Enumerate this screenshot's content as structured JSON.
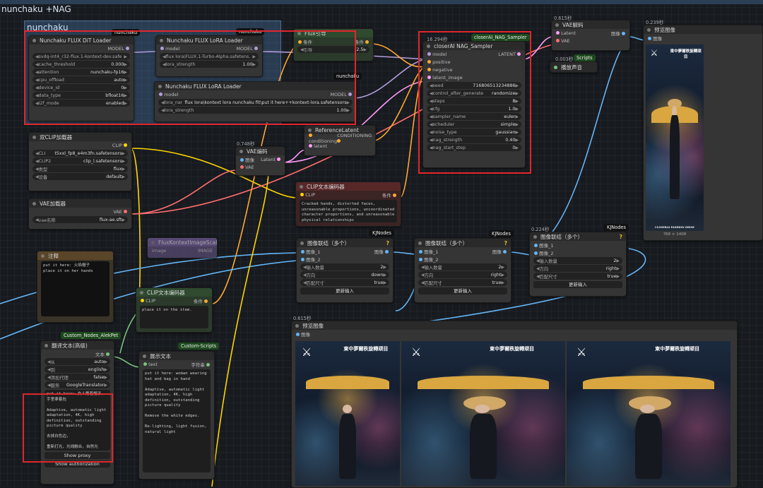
{
  "workflow_title": "nunchaku +NAG",
  "group_title": "nunchaku",
  "badges": {
    "nunchaku_1": "nunchaku",
    "nunchaku_2": "nunchaku",
    "nunchaku_3": "nunchaku",
    "closer": "closerAI_NAG_Sampler",
    "scripts": "Scripts",
    "kj1": "KJNodes",
    "kj2": "KJNodes",
    "kj3": "KJNodes",
    "alek": "Custom_Nodes_AlekPet",
    "custom_scripts": "Custom-Scripts"
  },
  "times": {
    "sampler": "16.294秒",
    "vae_decode": "0.615秒",
    "preview_top": "0.239秒",
    "vae_encode": "0.748秒",
    "play_sound": "0.003秒",
    "concat3": "0.224秒",
    "preview_bottom": "0.615秒"
  },
  "dit_loader": {
    "title": "Nunchaku FLUX DiT Loader",
    "out": "MODEL",
    "widgets": [
      {
        "n": "svdq-int4_r32-flux.1-kontext-dev.safet...",
        "v": ""
      },
      {
        "n": "cache_threshold",
        "v": "0.000"
      },
      {
        "n": "attention",
        "v": "nunchaku-fp16"
      },
      {
        "n": "cpu_offload",
        "v": "auto"
      },
      {
        "n": "device_id",
        "v": "0"
      },
      {
        "n": "data_type",
        "v": "bfloat16"
      },
      {
        "n": "i2f_mode",
        "v": "enabled"
      }
    ]
  },
  "lora1": {
    "title": "Nunchaku FLUX LoRA Loader",
    "in": "model",
    "out": "MODEL",
    "widgets": [
      {
        "n": "flux lora\\FLUX.1-Turbo-Alpha.safetens...",
        "v": ""
      },
      {
        "n": "lora_strength",
        "v": "1.00"
      }
    ]
  },
  "lora2": {
    "title": "Nunchaku FLUX LoRA Loader",
    "in": "model",
    "out": "MODEL",
    "widgets": [
      {
        "n": "lora_name",
        "v": "flux lora\\kontext lora nunchaku fit\\put it here++kontext-lora.safetensors"
      },
      {
        "n": "lora_strength",
        "v": "1.00"
      }
    ]
  },
  "flux_guide": {
    "title": "Flux引导",
    "in": "条件",
    "out": "条件",
    "widgets": [
      {
        "n": "引导",
        "v": "2.5"
      }
    ]
  },
  "nag_sampler": {
    "title": "closerAI NAG_Sampler",
    "inputs": [
      "model",
      "positive",
      "negative",
      "latent_image"
    ],
    "out": "LATENT",
    "widgets": [
      {
        "n": "seed",
        "v": "716806513234886"
      },
      {
        "n": "control_after_generate",
        "v": "randomize"
      },
      {
        "n": "steps",
        "v": "8"
      },
      {
        "n": "cfg",
        "v": "1.0"
      },
      {
        "n": "sampler_name",
        "v": "euler"
      },
      {
        "n": "scheduler",
        "v": "simple"
      },
      {
        "n": "noise_type",
        "v": "gaussian"
      },
      {
        "n": "nag_strength",
        "v": "0.40"
      },
      {
        "n": "nag_start_step",
        "v": "0"
      }
    ]
  },
  "vae_decode": {
    "title": "VAE解码",
    "inputs": [
      "Latent",
      "VAE"
    ],
    "out": "图像"
  },
  "play_sound": {
    "title": "播放声音"
  },
  "preview_top": {
    "title": "预览图像",
    "in": "图像",
    "size": "768 × 1408"
  },
  "dual_clip": {
    "title": "双CLIP加载器",
    "out": "CLIP",
    "widgets": [
      {
        "n": "CLI",
        "v": "t5xxl_fp8_e4m3fn.safetensors"
      },
      {
        "n": "CLIP2",
        "v": "clip_l.safetensors"
      },
      {
        "n": "类型",
        "v": "flux"
      },
      {
        "n": "设备",
        "v": "default"
      }
    ]
  },
  "vae_loader": {
    "title": "VAE加载器",
    "out": "VAE",
    "widgets": [
      {
        "n": "vae名称",
        "v": "flux-ae.sft"
      }
    ]
  },
  "vae_encode": {
    "title": "VAE编码",
    "inputs": [
      "图像",
      "VAE"
    ],
    "out": "Latent"
  },
  "ref_latent": {
    "title": "ReferenceLatent",
    "inputs": [
      "conditioning",
      "latent"
    ],
    "out": "CONDITIONING"
  },
  "clip_neg": {
    "title": "CLIP文本编码器",
    "in": "CLIP",
    "out": "条件",
    "text": "Cracked hands, distorted faces, unreasonable proportions, uncoordinated character proportions, and unreasonable physical relationships"
  },
  "flux_kontext_scale": {
    "title": "FluxKontextImageScale",
    "in": "image",
    "out": "IMAGE"
  },
  "note": {
    "title": "注释",
    "text": "put it here: 火焰帽子\nplace it on her hands"
  },
  "clip_pos": {
    "title": "CLIP文本编码器",
    "in": "CLIP",
    "out": "条件",
    "text": "place it on the item."
  },
  "concat1": {
    "title": "图像联结（多个）",
    "inputs": [
      "图像_1",
      "图像_2"
    ],
    "out": "图像",
    "widgets": [
      {
        "n": "输入数量",
        "v": "2"
      },
      {
        "n": "方向",
        "v": "down"
      },
      {
        "n": "匹配尺寸",
        "v": "true"
      }
    ],
    "button": "更新输入"
  },
  "concat2": {
    "title": "图像联结（多个）",
    "inputs": [
      "图像_1",
      "图像_2"
    ],
    "out": "图像",
    "widgets": [
      {
        "n": "输入数量",
        "v": "2"
      },
      {
        "n": "方向",
        "v": "right"
      },
      {
        "n": "匹配尺寸",
        "v": "true"
      }
    ],
    "button": "更新输入"
  },
  "concat3": {
    "title": "图像联结（多个）",
    "inputs": [
      "图像_1",
      "图像_2"
    ],
    "widgets": [
      {
        "n": "输入数量",
        "v": "2"
      },
      {
        "n": "方向",
        "v": "right"
      },
      {
        "n": "匹配尺寸",
        "v": "true"
      }
    ],
    "button": "更新输入"
  },
  "translate": {
    "title": "翻译文本(高级)",
    "out": "文本",
    "widgets": [
      {
        "n": "从",
        "v": "auto"
      },
      {
        "n": "到",
        "v": "english"
      },
      {
        "n": "添加代理",
        "v": "false"
      },
      {
        "n": "服务",
        "v": "GoogleTranslator"
      }
    ],
    "text": "put it here: 女人戴着帽子，手里拿着包\n\nAdaptive, automatic light adaptation, 4K, high definition, outstanding picture quality\n\n去掉白色边，\n\n重新打光，光线融合，自然光",
    "buttons": [
      "Show proxy",
      "Show authorization"
    ]
  },
  "show_text": {
    "title": "展示文本",
    "in": "text",
    "out": "字符串",
    "text": "put it here: woman wearing hat and bag in hand\n\nAdaptive, automatic light adaptation, 4K, high definition, outstanding picture quality\n\nRemove the white edges.\n\nRe-lighting, light fusion, natural light"
  },
  "preview_bottom": {
    "title": "预览图像",
    "in": "图像"
  },
  "poster": {
    "title": "東中夢爾秩旋轉顽目",
    "footer": "CLOSERAI FASHION SHOW"
  },
  "colors": {
    "red_box": "#e0262b",
    "model": "#b39ddb",
    "latent": "#ff9cf9",
    "vae": "#ff6e6e",
    "clip": "#ffd500",
    "cond": "#ffa931",
    "image": "#64b5f6"
  }
}
